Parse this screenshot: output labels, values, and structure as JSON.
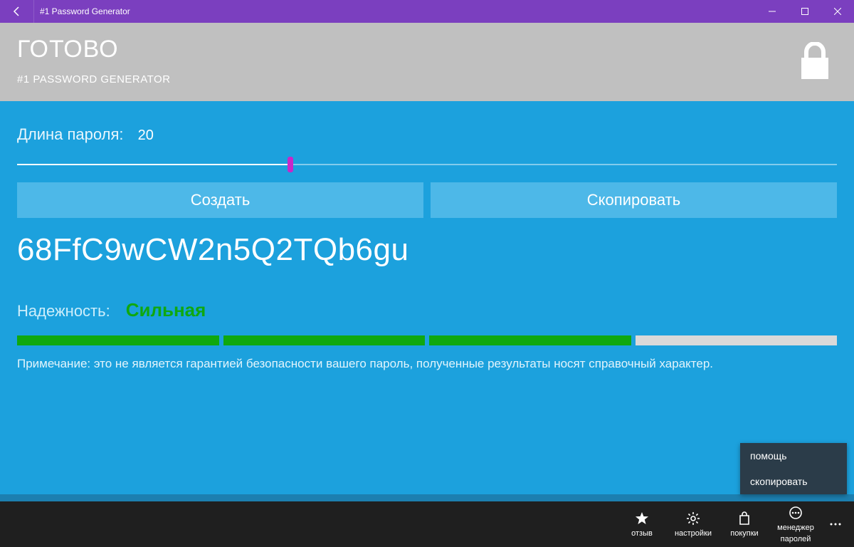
{
  "titlebar": {
    "title": "#1 Password Generator"
  },
  "header": {
    "status": "ГОТОВО",
    "subtitle": "#1 PASSWORD GENERATOR"
  },
  "length": {
    "label": "Длина пароля:",
    "value": "20",
    "percent": 33.3
  },
  "buttons": {
    "generate": "Создать",
    "copy": "Скопировать"
  },
  "password": "68FfC9wCW2n5Q2TQb6gu",
  "strength": {
    "label": "Надежность:",
    "value": "Сильная",
    "filled": 3,
    "total": 4
  },
  "note": "Примечание: это не является гарантией безопасности вашего пароль, полученные результаты носят справочный характер.",
  "overflow": {
    "help": "помощь",
    "copy": "скопировать"
  },
  "nav": {
    "review": "отзыв",
    "settings": "настройки",
    "purchases": "покупки",
    "manager_line1": "менеджер",
    "manager_line2": "паролей"
  }
}
